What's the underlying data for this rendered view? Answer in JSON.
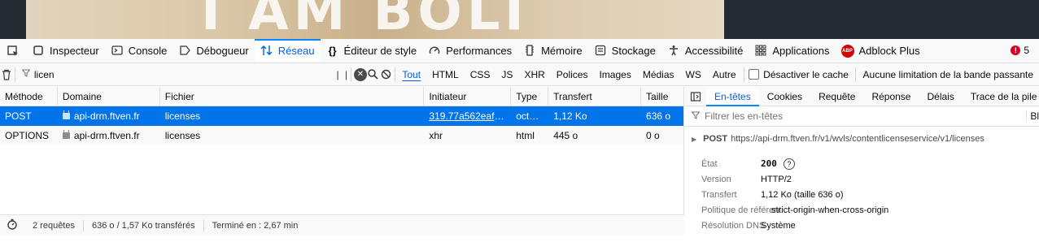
{
  "web": {
    "banner_text": "I AM BOLT"
  },
  "toolbar": {
    "tabs": [
      {
        "label": "Inspecteur",
        "icon": "inspector-icon"
      },
      {
        "label": "Console",
        "icon": "console-icon"
      },
      {
        "label": "Débogueur",
        "icon": "debugger-icon"
      },
      {
        "label": "Réseau",
        "icon": "network-icon"
      },
      {
        "label": "Éditeur de style",
        "icon": "style-editor-icon"
      },
      {
        "label": "Performances",
        "icon": "performance-icon"
      },
      {
        "label": "Mémoire",
        "icon": "memory-icon"
      },
      {
        "label": "Stockage",
        "icon": "storage-icon"
      },
      {
        "label": "Accessibilité",
        "icon": "accessibility-icon"
      },
      {
        "label": "Applications",
        "icon": "applications-icon"
      },
      {
        "label": "Adblock Plus",
        "icon": "adblock-icon"
      }
    ],
    "error_count": "5",
    "adblock_badge": "ABP"
  },
  "filter": {
    "value": "licen",
    "types": [
      "Tout",
      "HTML",
      "CSS",
      "JS",
      "XHR",
      "Polices",
      "Images",
      "Médias",
      "WS",
      "Autre"
    ],
    "disable_cache": "Désactiver le cache",
    "throttling": "Aucune limitation de la bande passante"
  },
  "table": {
    "headers": [
      "Méthode",
      "Domaine",
      "Fichier",
      "Initiateur",
      "Type",
      "Transfert",
      "Taille"
    ],
    "rows": [
      {
        "method": "POST",
        "domain": "api-drm.ftven.fr",
        "file": "licenses",
        "initiator": "319.77a562eaf63...",
        "type": "octet...",
        "transfer": "1,12 Ko",
        "size": "636 o"
      },
      {
        "method": "OPTIONS",
        "domain": "api-drm.ftven.fr",
        "file": "licenses",
        "initiator": "xhr",
        "type": "html",
        "transfer": "445 o",
        "size": "0 o"
      }
    ]
  },
  "status": {
    "requests": "2 requêtes",
    "transferred": "636 o / 1,57 Ko transférés",
    "finished": "Terminé en : 2,67 min"
  },
  "details": {
    "tabs": [
      "En-têtes",
      "Cookies",
      "Requête",
      "Réponse",
      "Délais",
      "Trace de la pile"
    ],
    "filter_placeholder": "Filtrer les en-têtes",
    "right_label": "Bl",
    "method": "POST",
    "url": "https://api-drm.ftven.fr/v1/wvls/contentlicenseservice/v1/licenses",
    "fields": [
      {
        "key": "État",
        "value": "200"
      },
      {
        "key": "Version",
        "value": "HTTP/2"
      },
      {
        "key": "Transfert",
        "value": "1,12 Ko (taille 636 o)"
      },
      {
        "key": "Politique de référent",
        "value": "strict-origin-when-cross-origin"
      },
      {
        "key": "Résolution DNS",
        "value": "Système"
      }
    ]
  }
}
